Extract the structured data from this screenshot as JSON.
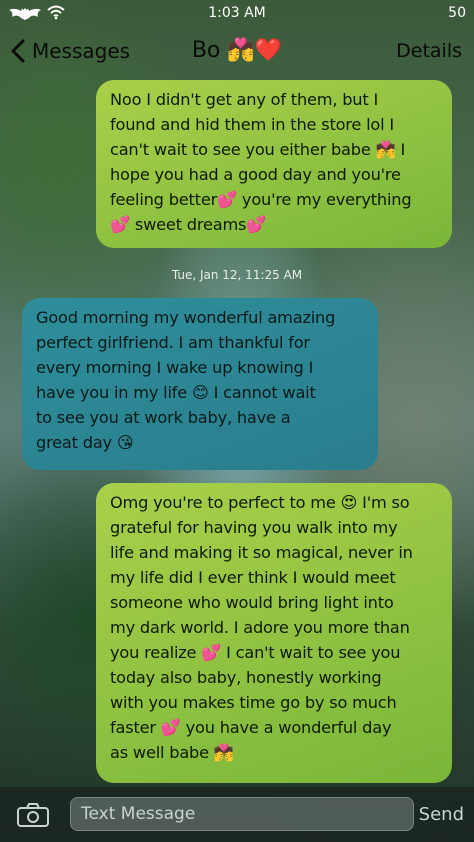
{
  "status_bar": {
    "time": "1:03 AM",
    "battery": "50",
    "icons": [
      "batman-logo-icon",
      "wifi-icon"
    ]
  },
  "nav": {
    "back_label": "Messages",
    "contact_name": "Bo 💏❤️",
    "details_label": "Details"
  },
  "messages": [
    {
      "direction": "outgoing",
      "text": "Noo I didn't get any of them, but I\nfound and hid them in the store lol I\ncan't wait to see you either babe 💏 I\nhope you had a good day and you're\nfeeling better💕 you're my everything\n💕 sweet dreams💕"
    },
    {
      "direction": "timestamp",
      "text": "Tue, Jan 12, 11:25 AM"
    },
    {
      "direction": "incoming",
      "text": "Good morning my wonderful amazing\nperfect girlfriend. I am thankful for\nevery morning I wake up knowing I\nhave you in my life 😊 I cannot wait\nto see you at work baby, have a\ngreat day 😘"
    },
    {
      "direction": "outgoing",
      "text": "Omg you're to perfect to me 😍 I'm so\ngrateful for having you walk into my\nlife and making it so magical, never in\nmy life did I ever think I would meet\nsomeone who would bring light into\nmy dark world. I adore you more than\nyou realize 💕 I can't wait to see you\ntoday also baby, honestly working\nwith you makes time go by so much\nfaster 💕 you have a wonderful day\nas well babe 💏"
    }
  ],
  "composer": {
    "placeholder": "Text Message",
    "send_label": "Send"
  },
  "colors": {
    "outgoing_bubble": "#94c442",
    "incoming_bubble": "#2c8592"
  }
}
